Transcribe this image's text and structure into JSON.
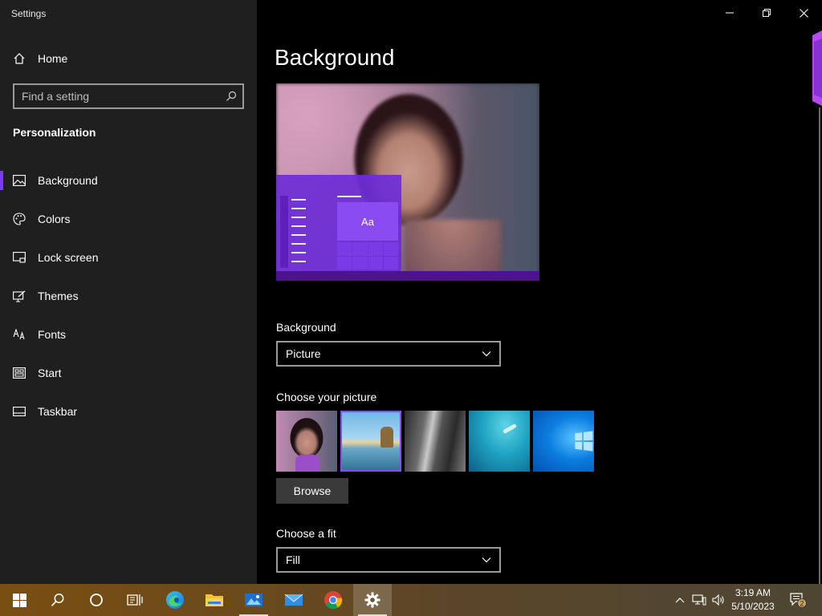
{
  "window": {
    "title": "Settings",
    "minimize_label": "",
    "restore_label": "",
    "close_label": ""
  },
  "sidebar": {
    "home_label": "Home",
    "search_placeholder": "Find a setting",
    "section_title": "Personalization",
    "items": [
      {
        "label": "Background",
        "icon": "picture-icon",
        "active": true
      },
      {
        "label": "Colors",
        "icon": "palette-icon",
        "active": false
      },
      {
        "label": "Lock screen",
        "icon": "lock-screen-icon",
        "active": false
      },
      {
        "label": "Themes",
        "icon": "themes-icon",
        "active": false
      },
      {
        "label": "Fonts",
        "icon": "fonts-icon",
        "active": false
      },
      {
        "label": "Start",
        "icon": "start-icon",
        "active": false
      },
      {
        "label": "Taskbar",
        "icon": "taskbar-icon",
        "active": false
      }
    ]
  },
  "main": {
    "page_title": "Background",
    "preview": {
      "tile_text": "Aa"
    },
    "background": {
      "label": "Background",
      "value": "Picture"
    },
    "choose_picture": {
      "label": "Choose your picture",
      "thumbnails": [
        "portrait-photo",
        "beach-rock-arch",
        "waterfall-cliff",
        "underwater-swimmer",
        "windows-logo-blue"
      ],
      "selected_index": 1
    },
    "browse_label": "Browse",
    "fit": {
      "label": "Choose a fit",
      "value": "Fill"
    }
  },
  "taskbar": {
    "icons": [
      "windows-start-icon",
      "search-icon",
      "cortana-icon",
      "task-view-icon",
      "edge-icon",
      "file-explorer-icon",
      "photos-icon",
      "mail-icon",
      "chrome-icon",
      "settings-icon"
    ],
    "tray_icons": [
      "chevron-up-icon",
      "network-icon",
      "volume-icon"
    ],
    "time": "3:19 AM",
    "date": "5/10/2023",
    "notification_count": "2"
  },
  "colors": {
    "accent": "#7a3cf0",
    "sidebar_bg": "#1f1f1f",
    "main_bg": "#000000"
  }
}
